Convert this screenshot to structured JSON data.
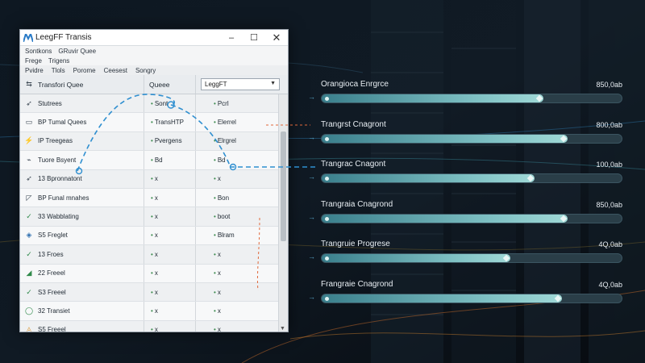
{
  "window": {
    "title": "LeegFF Transis",
    "controls": [
      "–",
      "☐",
      "✕"
    ]
  },
  "menus": {
    "row1": [
      "Sontkons",
      "GRuvir Quee"
    ],
    "row2": [
      "Frege",
      "Trigens"
    ],
    "row3": [
      "Pvidre",
      "Tlols",
      "Porome",
      "Ceesest",
      "Songry"
    ]
  },
  "grid": {
    "col1_header": "Transfori Quee",
    "col2_header": "Queee",
    "dropdown_value": "LeggFT",
    "top_rows": [
      {
        "c1": "Stutrees",
        "c2": "Sont",
        "c3": "Pcrl",
        "icon": "arrow-icon"
      },
      {
        "c1": "BP Tumal Quees",
        "c2": "TransHTP",
        "c3": "Elerrel",
        "icon": "monitor-icon"
      },
      {
        "c1": "IP Treegeas",
        "c2": "Pvergens",
        "c3": "Elrgrel",
        "icon": "bolt-icon"
      }
    ],
    "rows": [
      {
        "c1": "Tuore Bsyent",
        "c2": "Bd",
        "c3": "Bd",
        "icon": "tag-icon"
      },
      {
        "c1": "13 Bpronnatont",
        "c2": "x",
        "c3": "x",
        "icon": "arrow-icon"
      },
      {
        "c1": "BP Funal mnahes",
        "c2": "x",
        "c3": "Bon",
        "icon": "triangle-icon"
      },
      {
        "c1": "33 Wabblating",
        "c2": "x",
        "c3": "boot",
        "icon": "check-icon"
      },
      {
        "c1": "S5 Freglet",
        "c2": "x",
        "c3": "Blram",
        "icon": "shield-icon"
      },
      {
        "c1": "13 Froes",
        "c2": "x",
        "c3": "x",
        "icon": "check-icon"
      },
      {
        "c1": "22 Freeel",
        "c2": "x",
        "c3": "x",
        "icon": "chart-icon"
      },
      {
        "c1": "S3 Freeel",
        "c2": "x",
        "c3": "x",
        "icon": "check-icon"
      },
      {
        "c1": "32 Transiet",
        "c2": "x",
        "c3": "x",
        "icon": "circle-icon"
      },
      {
        "c1": "S5 Freeel",
        "c2": "x",
        "c3": "x",
        "icon": "warning-icon"
      }
    ]
  },
  "transfers": [
    {
      "label": "Orangioca Enrgrce",
      "size": "850,0ab",
      "progress": 0.74
    },
    {
      "label": "Trangrst Cnagront",
      "size": "800,0ab",
      "progress": 0.82
    },
    {
      "label": "Trangrac Cnagont",
      "size": "100,0ab",
      "progress": 0.71
    },
    {
      "label": "Trangraia Cnagrond",
      "size": "850,0ab",
      "progress": 0.82
    },
    {
      "label": "Trangruie Progrese",
      "size": "4Q,0ab",
      "progress": 0.63
    },
    {
      "label": "Frangraie Cnagrond",
      "size": "4Q,0ab",
      "progress": 0.8
    }
  ],
  "colors": {
    "bar_fill": "#7fc1c4",
    "arrow": "#3ea1d9"
  }
}
